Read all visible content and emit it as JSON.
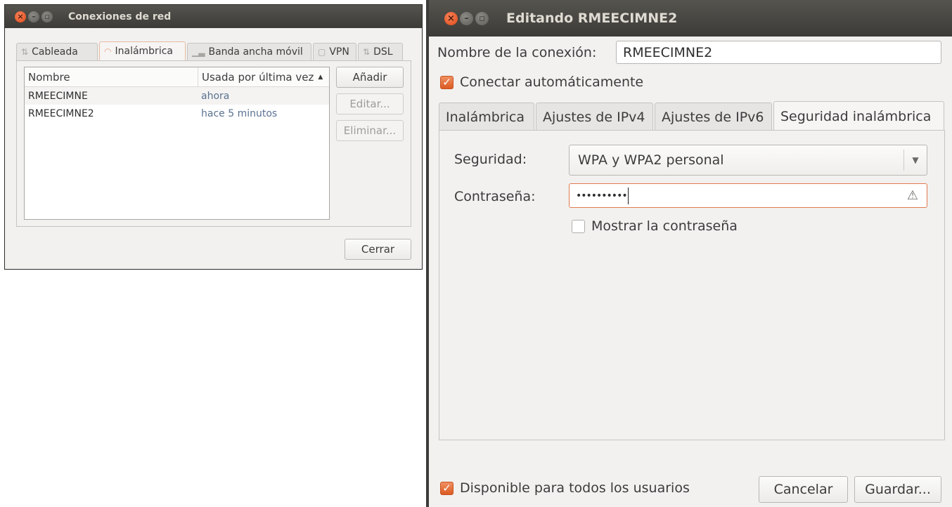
{
  "connections_window": {
    "title": "Conexiones de red",
    "tabs": [
      {
        "label": "Cableada",
        "icon": "wired-icon"
      },
      {
        "label": "Inalámbrica",
        "icon": "wifi-icon"
      },
      {
        "label": "Banda ancha móvil",
        "icon": "signal-icon"
      },
      {
        "label": "VPN",
        "icon": "lock-icon"
      },
      {
        "label": "DSL",
        "icon": "dsl-icon"
      }
    ],
    "active_tab": "Inalámbrica",
    "list": {
      "headers": [
        "Nombre",
        "Usada por última vez"
      ],
      "sort_indicator": "▲",
      "rows": [
        {
          "name": "RMEECIMNE",
          "last_used": "ahora"
        },
        {
          "name": "RMEECIMNE2",
          "last_used": "hace 5 minutos"
        }
      ]
    },
    "buttons": {
      "add": "Añadir",
      "edit": "Editar...",
      "delete": "Eliminar...",
      "close": "Cerrar"
    }
  },
  "edit_window": {
    "title": "Editando RMEECIMNE2",
    "connection_name_label": "Nombre de la conexión:",
    "connection_name_value": "RMEECIMNE2",
    "auto_connect_label": "Conectar automáticamente",
    "auto_connect_checked": true,
    "tabs": [
      "Inalámbrica",
      "Ajustes de IPv4",
      "Ajustes de IPv6",
      "Seguridad inalámbrica"
    ],
    "active_tab": "Seguridad inalámbrica",
    "security_label": "Seguridad:",
    "security_value": "WPA y WPA2 personal",
    "password_label": "Contraseña:",
    "password_masked": "••••••••••",
    "show_password_label": "Mostrar la contraseña",
    "show_password_checked": false,
    "all_users_label": "Disponible para todos los usuarios",
    "all_users_checked": true,
    "buttons": {
      "cancel": "Cancelar",
      "save": "Guardar..."
    }
  },
  "colors": {
    "accent": "#dd5a22",
    "titlebar": "#3c3b37",
    "window_bg": "#f2f1f0"
  }
}
